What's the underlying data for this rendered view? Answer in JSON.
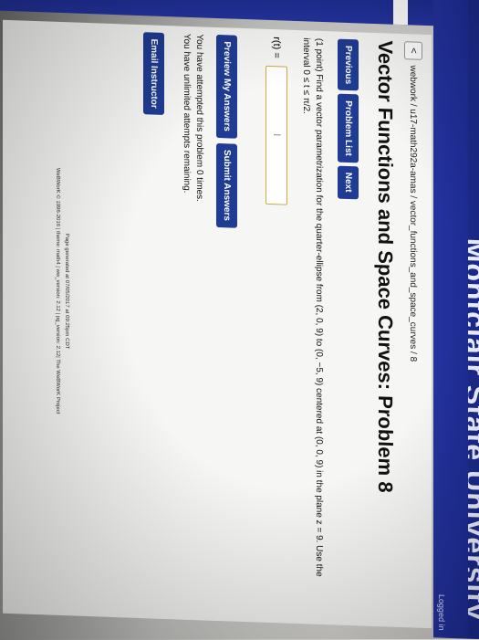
{
  "banner": {
    "text": "Montclair State University",
    "logged_in": "Logged in"
  },
  "breadcrumb": {
    "back_label": "<",
    "path": "webwork / u17-math292a-amas / vector_functions_and_space_curves / 8"
  },
  "title": "Vector Functions and Space Curves: Problem 8",
  "nav": {
    "previous": "Previous",
    "problem_list": "Problem List",
    "next": "Next"
  },
  "problem": {
    "text": "(1 point) Find a vector parametrization for the quarter-ellipse from (2, 0, 9) to (0, −5, 9) centered at (0, 0, 9) in the plane z = 9. Use the interval 0 ≤ t ≤ π/2."
  },
  "answer": {
    "label": "r(t) =",
    "value": "",
    "cursor": "I"
  },
  "actions": {
    "preview": "Preview My Answers",
    "submit": "Submit Answers"
  },
  "status": {
    "attempts": "You have attempted this problem 0 times.",
    "remaining": "You have unlimited attempts remaining."
  },
  "email": {
    "label": "Email Instructor"
  },
  "footer": {
    "generated": "Page generated at 07/05/2017 at 09:25pm CDT",
    "credits": "WeBWorK © 1996-2016 | theme: math4 | ww_version: 2.12 | pg_version: 2.12| The WeBWorK Project"
  }
}
